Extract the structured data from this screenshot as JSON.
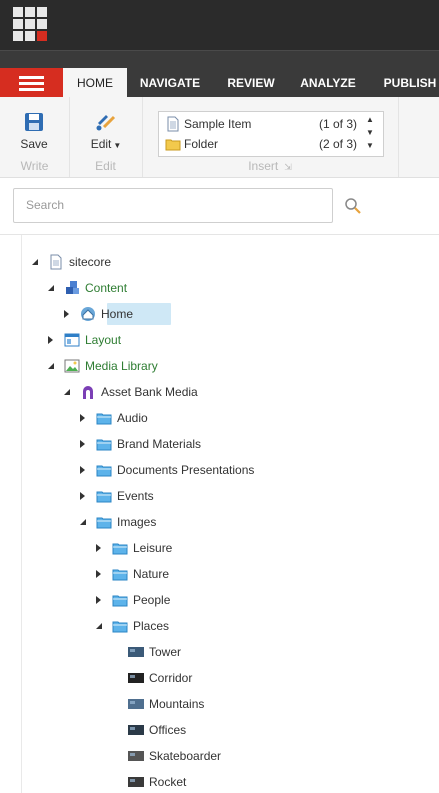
{
  "topbar": {
    "logo_icon": "sitecore-launchpad-grid-icon"
  },
  "tabs": {
    "menu_icon": "hamburger-menu-icon",
    "items": [
      {
        "label": "HOME",
        "active": true
      },
      {
        "label": "NAVIGATE",
        "active": false
      },
      {
        "label": "REVIEW",
        "active": false
      },
      {
        "label": "ANALYZE",
        "active": false
      },
      {
        "label": "PUBLISH",
        "active": false
      }
    ]
  },
  "ribbon": {
    "write": {
      "save_label": "Save",
      "caption": "Write"
    },
    "edit": {
      "edit_label": "Edit",
      "caption": "Edit"
    },
    "insert": {
      "caption": "Insert",
      "items": [
        {
          "label": "Sample Item",
          "count": "(1 of 3)"
        },
        {
          "label": "Folder",
          "count": "(2 of 3)"
        }
      ]
    }
  },
  "search": {
    "placeholder": "Search",
    "value": ""
  },
  "tree": [
    {
      "label": "sitecore",
      "icon": "page-icon",
      "state": "expanded",
      "green": false,
      "selected": false
    },
    {
      "label": "Content",
      "icon": "content-cubes-icon",
      "state": "expanded",
      "green": true,
      "selected": false
    },
    {
      "label": "Home",
      "icon": "home-icon",
      "state": "collapsed",
      "green": false,
      "selected": true
    },
    {
      "label": "Layout",
      "icon": "layout-icon",
      "state": "collapsed",
      "green": true,
      "selected": false
    },
    {
      "label": "Media Library",
      "icon": "media-library-icon",
      "state": "expanded",
      "green": true,
      "selected": false
    },
    {
      "label": "Asset Bank Media",
      "icon": "asset-bank-icon",
      "state": "expanded",
      "green": false,
      "selected": false
    },
    {
      "label": "Audio",
      "icon": "folder-icon",
      "state": "collapsed",
      "green": false,
      "selected": false
    },
    {
      "label": "Brand Materials",
      "icon": "folder-icon",
      "state": "collapsed",
      "green": false,
      "selected": false
    },
    {
      "label": "Documents Presentations",
      "icon": "folder-icon",
      "state": "collapsed",
      "green": false,
      "selected": false
    },
    {
      "label": "Events",
      "icon": "folder-icon",
      "state": "collapsed",
      "green": false,
      "selected": false
    },
    {
      "label": "Images",
      "icon": "folder-icon",
      "state": "expanded",
      "green": false,
      "selected": false
    },
    {
      "label": "Leisure",
      "icon": "folder-icon",
      "state": "collapsed",
      "green": false,
      "selected": false
    },
    {
      "label": "Nature",
      "icon": "folder-icon",
      "state": "collapsed",
      "green": false,
      "selected": false
    },
    {
      "label": "People",
      "icon": "folder-icon",
      "state": "collapsed",
      "green": false,
      "selected": false
    },
    {
      "label": "Places",
      "icon": "folder-icon",
      "state": "expanded",
      "green": false,
      "selected": false
    },
    {
      "label": "Tower",
      "icon": "image-thumbnail-icon",
      "state": "leaf",
      "green": false,
      "selected": false
    },
    {
      "label": "Corridor",
      "icon": "image-thumbnail-icon",
      "state": "leaf",
      "green": false,
      "selected": false
    },
    {
      "label": "Mountains",
      "icon": "image-thumbnail-icon",
      "state": "leaf",
      "green": false,
      "selected": false
    },
    {
      "label": "Offices",
      "icon": "image-thumbnail-icon",
      "state": "leaf",
      "green": false,
      "selected": false
    },
    {
      "label": "Skateboarder",
      "icon": "image-thumbnail-icon",
      "state": "leaf",
      "green": false,
      "selected": false
    },
    {
      "label": "Rocket",
      "icon": "image-thumbnail-icon",
      "state": "leaf",
      "green": false,
      "selected": false
    }
  ],
  "colors": {
    "accent_red": "#d62d20",
    "tree_green": "#2e7d32",
    "selection": "#cfe8f6",
    "folder_blue": "#4aa3df",
    "topbar": "#2b2b2b"
  }
}
